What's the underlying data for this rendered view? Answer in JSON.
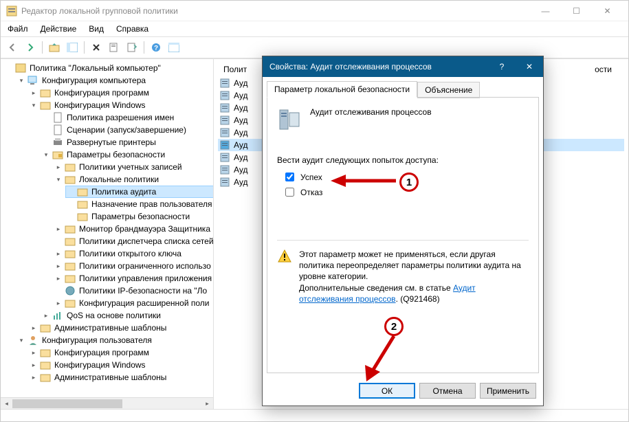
{
  "window": {
    "title": "Редактор локальной групповой политики",
    "controls": {
      "minimize": "—",
      "maximize": "☐",
      "close": "✕"
    }
  },
  "menu": [
    "Файл",
    "Действие",
    "Вид",
    "Справка"
  ],
  "toolbar_icons": [
    "back",
    "forward",
    "up",
    "lines",
    "delete",
    "refresh",
    "export",
    "help",
    "details"
  ],
  "tree": {
    "root": "Политика \"Локальный компьютер\"",
    "computer_config": "Конфигурация компьютера",
    "software": "Конфигурация программ",
    "windows_config": "Конфигурация Windows",
    "name_policy": "Политика разрешения имен",
    "scripts": "Сценарии (запуск/завершение)",
    "printers": "Развернутые принтеры",
    "security": "Параметры безопасности",
    "account_policies": "Политики учетных записей",
    "local_policies": "Локальные политики",
    "audit_policy": "Политика аудита",
    "user_rights": "Назначение прав пользователя",
    "security_options": "Параметры безопасности",
    "firewall": "Монитор брандмауэра Защитника",
    "netlist": "Политики диспетчера списка сетей",
    "pubkey": "Политики открытого ключа",
    "restrict": "Политики ограниченного использо",
    "appctrl": "Политики управления приложения",
    "ipsec": "Политики IP-безопасности на \"Ло",
    "advaudit": "Конфигурация расширенной поли",
    "qos": "QoS на основе политики",
    "admin_templates_c": "Административные шаблоны",
    "user_config": "Конфигурация пользователя",
    "software2": "Конфигурация программ",
    "windows_config2": "Конфигурация Windows",
    "admin_templates_u": "Административные шаблоны"
  },
  "list": {
    "col_policy": "Полит",
    "col_param": "ости",
    "items": [
      {
        "name": "Ауд",
        "icon": "audit"
      },
      {
        "name": "Ауд",
        "icon": "audit"
      },
      {
        "name": "Ауд",
        "icon": "audit"
      },
      {
        "name": "Ауд",
        "icon": "audit"
      },
      {
        "name": "Ауд",
        "icon": "audit"
      },
      {
        "name": "Ауд",
        "icon": "audit-selected"
      },
      {
        "name": "Ауд",
        "icon": "audit"
      },
      {
        "name": "Ауд",
        "icon": "audit"
      },
      {
        "name": "Ауд",
        "icon": "audit"
      }
    ]
  },
  "dialog": {
    "title": "Свойства: Аудит отслеживания процессов",
    "tab_local": "Параметр локальной безопасности",
    "tab_explain": "Объяснение",
    "policy_name": "Аудит отслеживания процессов",
    "audit_prompt": "Вести аудит следующих попыток доступа:",
    "success": "Успех",
    "failure": "Отказ",
    "success_checked": true,
    "failure_checked": false,
    "warning": "Этот параметр может не применяться, если другая политика переопределяет параметры политики аудита на уровне категории.",
    "more_info_prefix": "Дополнительные сведения см. в статье ",
    "more_info_link": "Аудит отслеживания процессов",
    "kb": ". (Q921468)",
    "ok": "ОК",
    "cancel": "Отмена",
    "apply": "Применить"
  },
  "annotations": {
    "one": "1",
    "two": "2"
  }
}
